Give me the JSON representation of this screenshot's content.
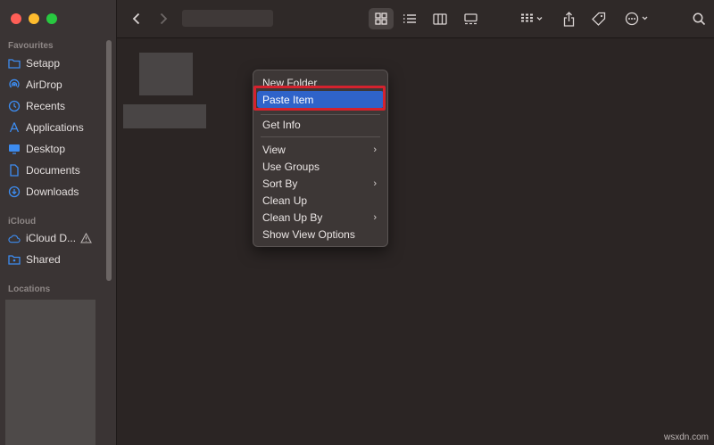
{
  "window": {
    "traffic_lights": [
      {
        "name": "close",
        "color": "#fe5f57"
      },
      {
        "name": "minimize",
        "color": "#febc2e"
      },
      {
        "name": "zoom",
        "color": "#28c840"
      }
    ]
  },
  "sidebar": {
    "sections": {
      "favourites": "Favourites",
      "icloud": "iCloud",
      "locations": "Locations"
    },
    "favourites": [
      {
        "label": "Setapp",
        "icon": "folder-icon"
      },
      {
        "label": "AirDrop",
        "icon": "airdrop-icon"
      },
      {
        "label": "Recents",
        "icon": "clock-icon"
      },
      {
        "label": "Applications",
        "icon": "applications-icon"
      },
      {
        "label": "Desktop",
        "icon": "desktop-icon"
      },
      {
        "label": "Documents",
        "icon": "document-icon"
      },
      {
        "label": "Downloads",
        "icon": "download-icon"
      }
    ],
    "icloud": [
      {
        "label": "iCloud D...",
        "icon": "cloud-icon"
      },
      {
        "label": "Shared",
        "icon": "shared-folder-icon"
      }
    ]
  },
  "toolbar": {
    "buttons": [
      "back-icon",
      "forward-icon",
      "icon-view",
      "list-view",
      "column-view",
      "gallery-view",
      "group-by",
      "share-icon",
      "tag-icon",
      "more-icon",
      "search-icon"
    ],
    "active_view": "icon-view"
  },
  "context_menu": {
    "items": [
      {
        "label": "New Folder"
      },
      {
        "label": "Paste Item",
        "highlighted": true
      },
      {
        "label": "Get Info"
      },
      {
        "label": "View",
        "submenu": true
      },
      {
        "label": "Use Groups"
      },
      {
        "label": "Sort By",
        "submenu": true
      },
      {
        "label": "Clean Up"
      },
      {
        "label": "Clean Up By",
        "submenu": true
      },
      {
        "label": "Show View Options"
      }
    ],
    "submenu_glyph": "›"
  },
  "colors": {
    "accent": "#2f63c9",
    "annotation": "#d4222e",
    "sidebar_icon": "#3d8cf0"
  },
  "watermark": "wsxdn.com"
}
